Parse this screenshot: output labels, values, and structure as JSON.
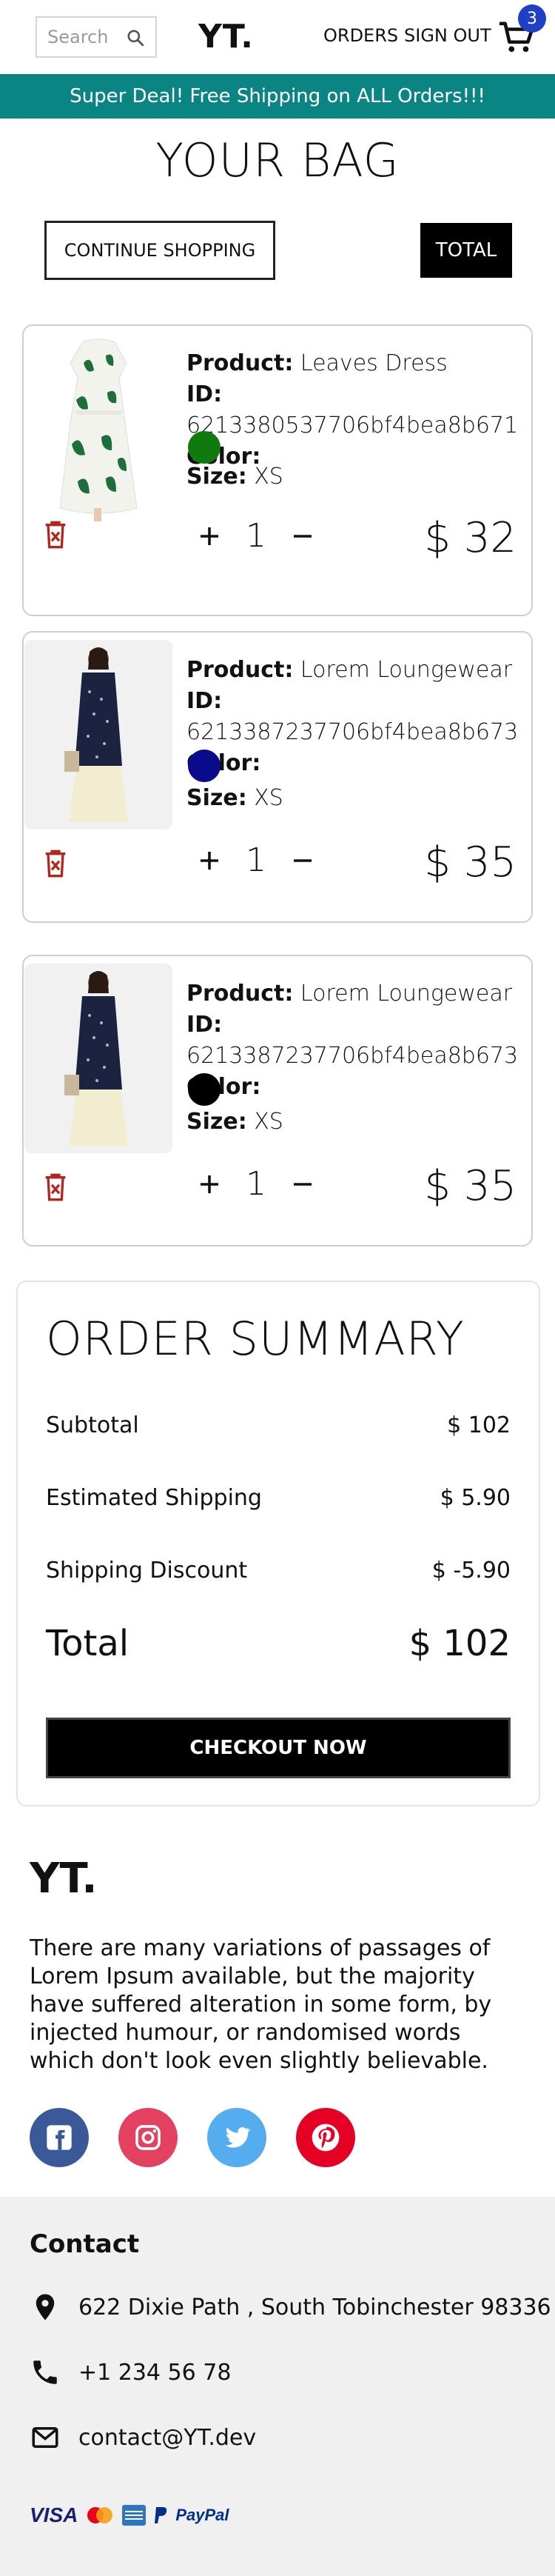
{
  "nav": {
    "search_placeholder": "Search",
    "logo": "YT.",
    "orders": "ORDERS",
    "sign_out": "SIGN OUT",
    "cart_count": "3"
  },
  "announcement": "Super Deal! Free Shipping on ALL Orders!!!",
  "page_title": "YOUR BAG",
  "buttons": {
    "continue": "CONTINUE SHOPPING",
    "total": "TOTAL",
    "checkout": "CHECKOUT NOW"
  },
  "labels": {
    "product": "Product:",
    "id": "ID:",
    "color": "Color:",
    "size": "Size:"
  },
  "items": [
    {
      "product": "Leaves Dress",
      "id": "6213380537706bf4bea8b671",
      "color": "#117a0e",
      "size": "XS",
      "qty": "1",
      "price": "$ 32"
    },
    {
      "product": "Lorem Loungewear",
      "id": "6213387237706bf4bea8b673",
      "color": "#0a0a8c",
      "size": "XS",
      "qty": "1",
      "price": "$ 35"
    },
    {
      "product": "Lorem Loungewear",
      "id": "6213387237706bf4bea8b673",
      "color": "#000000",
      "size": "XS",
      "qty": "1",
      "price": "$ 35"
    }
  ],
  "summary": {
    "title": "ORDER SUMMARY",
    "subtotal_label": "Subtotal",
    "subtotal": "$ 102",
    "shipping_label": "Estimated Shipping",
    "shipping": "$ 5.90",
    "discount_label": "Shipping Discount",
    "discount": "$ -5.90",
    "total_label": "Total",
    "total": "$ 102"
  },
  "footer": {
    "logo": "YT.",
    "description": "There are many variations of passages of Lorem Ipsum available, but the majority have suffered alteration in some form, by injected humour, or randomised words which don't look even slightly believable.",
    "social": [
      {
        "icon": "facebook-icon",
        "color": "#3b5999"
      },
      {
        "icon": "instagram-icon",
        "color": "#e4405f"
      },
      {
        "icon": "twitter-icon",
        "color": "#55acee"
      },
      {
        "icon": "pinterest-icon",
        "color": "#e60023"
      }
    ]
  },
  "contact": {
    "title": "Contact",
    "address": "622 Dixie Path , South Tobinchester 98336",
    "phone": "+1 234 56 78",
    "email": "contact@YT.dev"
  },
  "payment": {
    "visa": "VISA",
    "paypal": "PayPal"
  },
  "colors": {
    "accent": "#0a8584",
    "badge": "#1f3fc4",
    "trash": "#b3261e"
  }
}
